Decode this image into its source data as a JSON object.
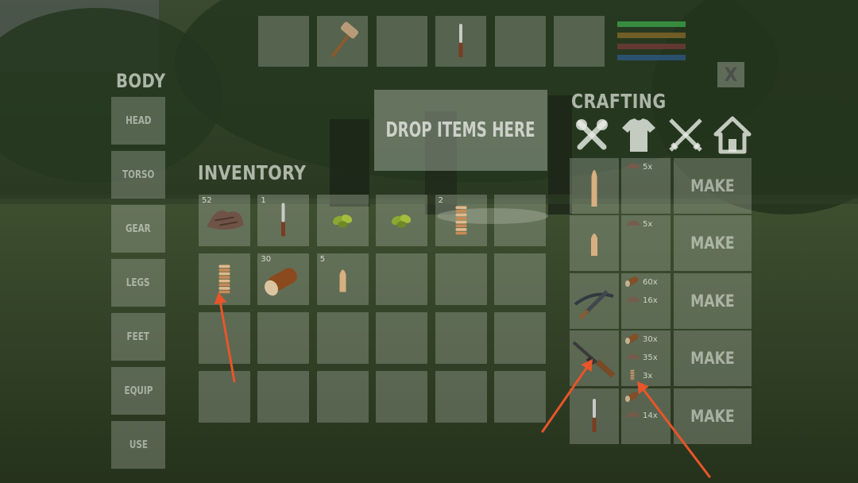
{
  "hotbar": [
    {
      "item": "",
      "icon": "empty"
    },
    {
      "item": "stone-hammer",
      "icon": "hammer-icon"
    },
    {
      "item": "",
      "icon": "empty"
    },
    {
      "item": "knife",
      "icon": "knife-icon"
    },
    {
      "item": "",
      "icon": "empty"
    },
    {
      "item": "",
      "icon": "empty"
    }
  ],
  "stat_bars": [
    {
      "name": "health",
      "color": "#3fa84a"
    },
    {
      "name": "hunger",
      "color": "#8a6a2a"
    },
    {
      "name": "thirst",
      "color": "#7a3a3a"
    },
    {
      "name": "stamina",
      "color": "#2f5a8a"
    }
  ],
  "close_label": "X",
  "body": {
    "title": "BODY",
    "slots": [
      "HEAD",
      "TORSO",
      "GEAR",
      "LEGS",
      "FEET",
      "EQUIP",
      "USE"
    ]
  },
  "drop_zone": {
    "label": "DROP ITEMS HERE"
  },
  "inventory": {
    "title": "INVENTORY",
    "slots": [
      {
        "qty": "52",
        "icon": "cloth-scraps-icon"
      },
      {
        "qty": "1",
        "icon": "knife-icon"
      },
      {
        "qty": "",
        "icon": "seeds-icon"
      },
      {
        "qty": "",
        "icon": "seeds-icon"
      },
      {
        "qty": "2",
        "icon": "rope-coil-icon"
      },
      {
        "qty": "",
        "icon": "empty"
      },
      {
        "qty": "",
        "icon": "rope-coil-icon"
      },
      {
        "qty": "30",
        "icon": "wood-log-icon"
      },
      {
        "qty": "5",
        "icon": "bullet-icon"
      },
      {
        "qty": "",
        "icon": "empty"
      },
      {
        "qty": "",
        "icon": "empty"
      },
      {
        "qty": "",
        "icon": "empty"
      },
      {
        "qty": "",
        "icon": "empty"
      },
      {
        "qty": "",
        "icon": "empty"
      },
      {
        "qty": "",
        "icon": "empty"
      },
      {
        "qty": "",
        "icon": "empty"
      },
      {
        "qty": "",
        "icon": "empty"
      },
      {
        "qty": "",
        "icon": "empty"
      },
      {
        "qty": "",
        "icon": "empty"
      },
      {
        "qty": "",
        "icon": "empty"
      },
      {
        "qty": "",
        "icon": "empty"
      },
      {
        "qty": "",
        "icon": "empty"
      },
      {
        "qty": "",
        "icon": "empty"
      },
      {
        "qty": "",
        "icon": "empty"
      }
    ]
  },
  "crafting": {
    "title": "CRAFTING",
    "categories": [
      "tools-icon",
      "clothing-icon",
      "weapons-icon",
      "building-icon"
    ],
    "recipes": [
      {
        "result": "rifle-bullet-icon",
        "requirements": [
          {
            "icon": "scrap-icon",
            "amount": "5x"
          }
        ],
        "make": "MAKE"
      },
      {
        "result": "pistol-bullet-icon",
        "requirements": [
          {
            "icon": "scrap-icon",
            "amount": "5x"
          }
        ],
        "make": "MAKE"
      },
      {
        "result": "crossbow-icon",
        "requirements": [
          {
            "icon": "wood-icon",
            "amount": "60x"
          },
          {
            "icon": "scrap-icon",
            "amount": "16x"
          }
        ],
        "make": "MAKE"
      },
      {
        "result": "rifle-icon",
        "requirements": [
          {
            "icon": "wood-icon",
            "amount": "30x"
          },
          {
            "icon": "scrap-icon",
            "amount": "35x"
          },
          {
            "icon": "rope-icon",
            "amount": "3x"
          }
        ],
        "make": "MAKE"
      },
      {
        "result": "knife-icon",
        "requirements": [
          {
            "icon": "wood-icon",
            "amount": ""
          },
          {
            "icon": "scrap-icon",
            "amount": "14x"
          }
        ],
        "make": "MAKE"
      }
    ]
  },
  "annotation_color": "#e8552a"
}
